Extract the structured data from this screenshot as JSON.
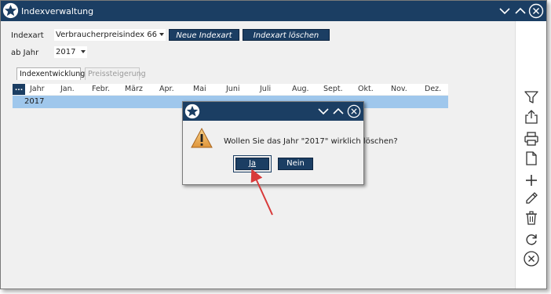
{
  "window": {
    "title": "Indexverwaltung"
  },
  "form": {
    "indexart_label": "Indexart",
    "indexart_value": "Verbraucherpreisindex 66",
    "ab_jahr_label": "ab Jahr",
    "ab_jahr_value": "2017",
    "neue_indexart_label": "Neue Indexart",
    "indexart_loeschen_label": "Indexart löschen"
  },
  "tabs": [
    {
      "label": "Indexentwicklung",
      "active": true
    },
    {
      "label": "Preissteigerung",
      "active": false
    }
  ],
  "grid": {
    "menu_label": "...",
    "columns": [
      "Jahr",
      "Jan.",
      "Febr.",
      "März",
      "Apr.",
      "Mai",
      "Juni",
      "Juli",
      "Aug.",
      "Sept.",
      "Okt.",
      "Nov.",
      "Dez."
    ],
    "rows": [
      {
        "year": "2017"
      }
    ]
  },
  "dialog": {
    "message": "Wollen Sie das Jahr \"2017\" wirklich löschen?",
    "yes_label": "Ja",
    "no_label": "Nein"
  },
  "sidebar": {
    "icons": [
      "filter-icon",
      "share-icon",
      "print-icon",
      "document-icon",
      "plus-icon",
      "pencil-icon",
      "trash-icon",
      "refresh-icon",
      "close-circle-icon"
    ]
  },
  "colors": {
    "titlebar": "#1b3e63",
    "selected_row": "#9fc7ec",
    "arrow": "#d83a3a"
  }
}
